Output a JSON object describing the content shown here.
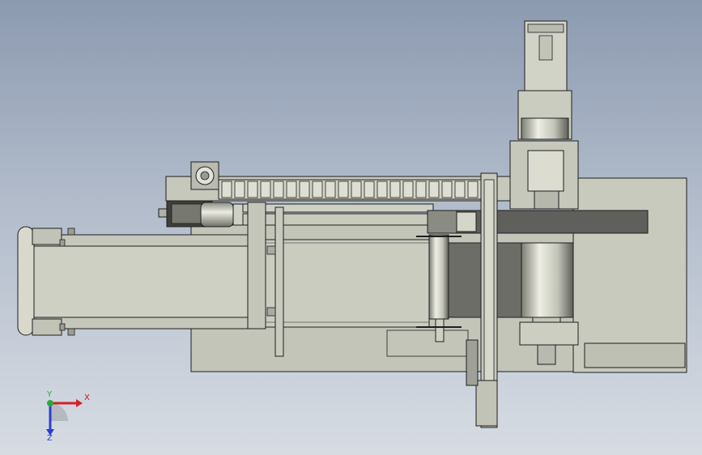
{
  "viewport": {
    "background_top": "#8c9ab0",
    "background_bottom": "#d7dce3"
  },
  "part_colors": {
    "light_gray": "#c8c9bd",
    "mid_gray": "#a8a9a0",
    "dark_gray": "#5e5f5a",
    "belt_dark": "#6d6e68",
    "steel": "#d9d9cf",
    "outline": "#1e1e1e"
  },
  "triad": {
    "x_label": "X",
    "y_label": "Y",
    "z_label": "Z",
    "x_color": "#d4202a",
    "y_color": "#2fa83a",
    "z_color": "#2a3fd0"
  }
}
